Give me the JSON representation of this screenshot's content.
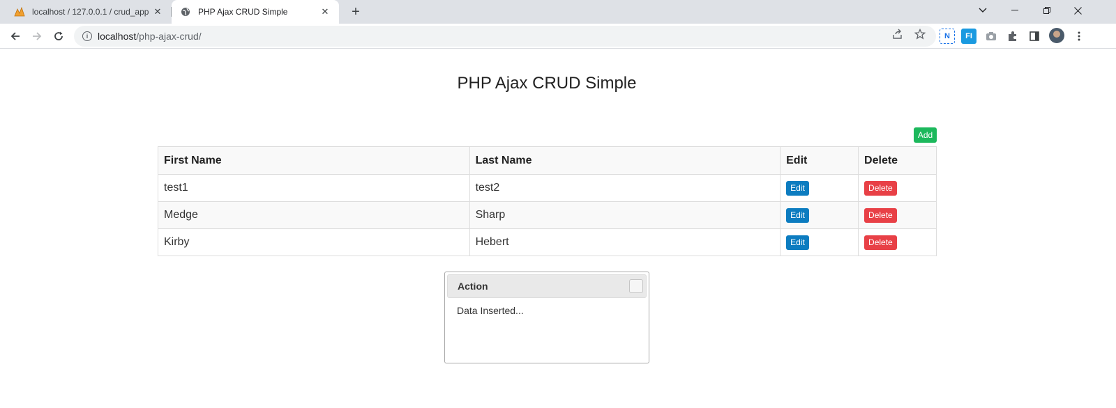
{
  "browser": {
    "tabs": [
      {
        "title": "localhost / 127.0.0.1 / crud_app |",
        "favicon": "phpmyadmin-icon",
        "active": false
      },
      {
        "title": "PHP Ajax CRUD Simple",
        "favicon": "globe-icon",
        "active": true
      }
    ],
    "address": {
      "host": "localhost",
      "path": "/php-ajax-crud/"
    },
    "extensions": [
      {
        "name": "n-extension-icon",
        "label": "N",
        "color": "#1a73e8"
      },
      {
        "name": "fi-extension-icon",
        "label": "FI",
        "color": "#1a9ae0"
      }
    ]
  },
  "page": {
    "title": "PHP Ajax CRUD Simple",
    "add_label": "Add",
    "table": {
      "headers": [
        "First Name",
        "Last Name",
        "Edit",
        "Delete"
      ],
      "rows": [
        {
          "first": "test1",
          "last": "test2",
          "edit": "Edit",
          "delete": "Delete"
        },
        {
          "first": "Medge",
          "last": "Sharp",
          "edit": "Edit",
          "delete": "Delete"
        },
        {
          "first": "Kirby",
          "last": "Hebert",
          "edit": "Edit",
          "delete": "Delete"
        }
      ]
    },
    "dialog": {
      "title": "Action",
      "message": "Data Inserted..."
    }
  },
  "colors": {
    "add": "#1cb85c",
    "edit": "#0c7cc0",
    "delete": "#e84046"
  }
}
